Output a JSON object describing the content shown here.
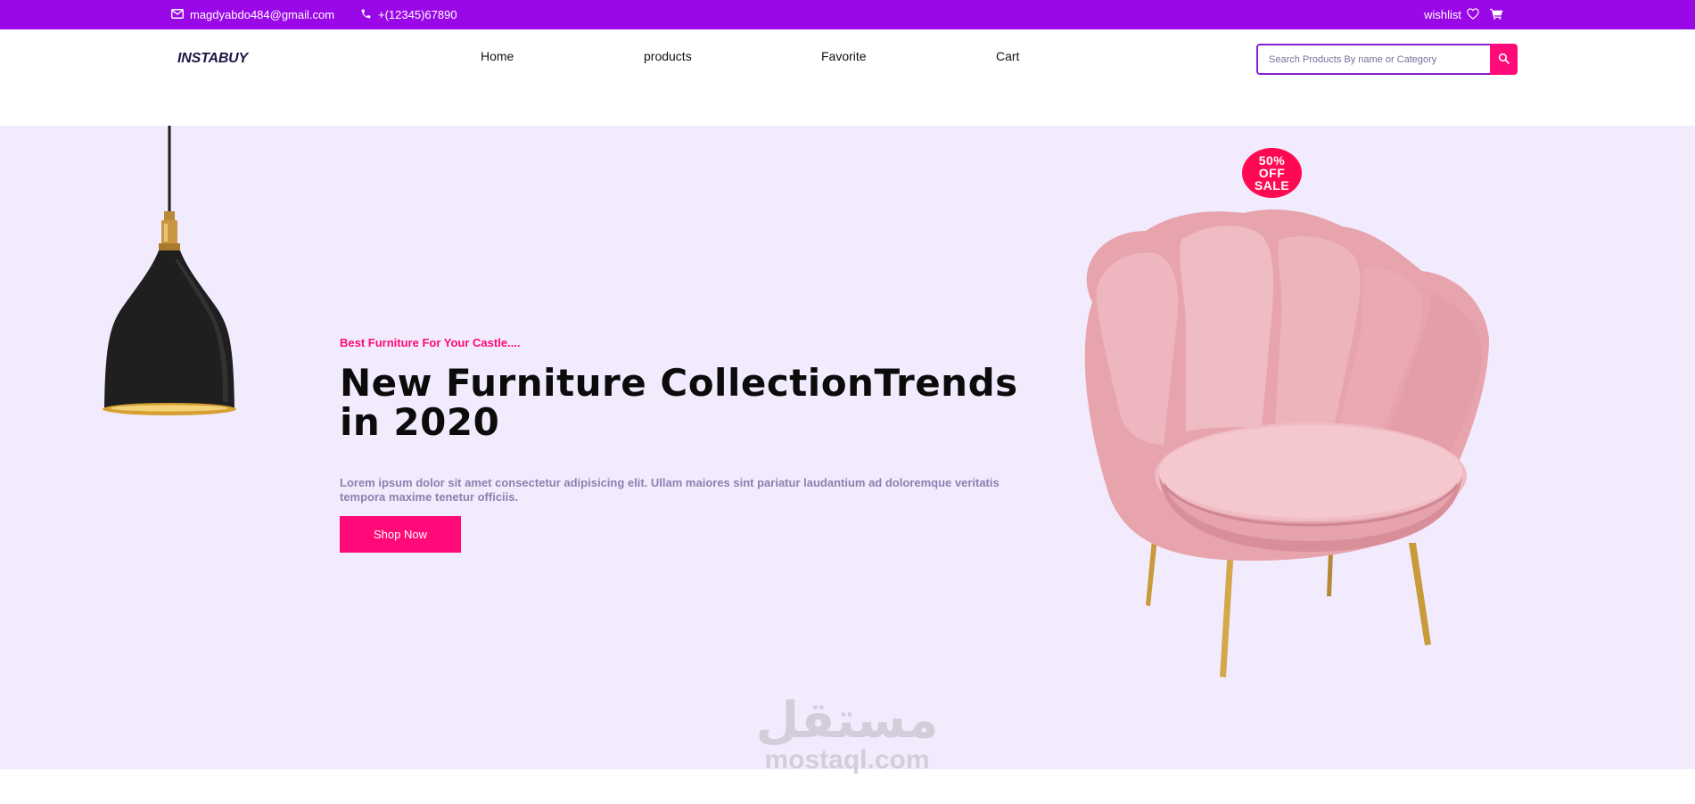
{
  "topbar": {
    "email": "magdyabdo484@gmail.com",
    "phone": "+(12345)67890",
    "wishlist_label": "wishlist",
    "icons": [
      "envelope-icon",
      "phone-icon",
      "heart-icon",
      "cart-icon"
    ]
  },
  "navbar": {
    "logo": "INSTABUY",
    "links": [
      "Home",
      "products",
      "Favorite",
      "Cart"
    ],
    "search_placeholder": "Search Products By name or Category",
    "search_icon": "search-icon"
  },
  "hero": {
    "tagline": "Best Furniture For Your Castle....",
    "headline": "New Furniture CollectionTrends in 2020",
    "description": "Lorem ipsum dolor sit amet consectetur adipisicing elit. Ullam maiores sint pariatur laudantium ad doloremque veritatis tempora maxime tenetur officiis.",
    "button_label": "Shop Now",
    "sale_badge": [
      "50%",
      "OFF",
      "SALE"
    ]
  },
  "watermark": {
    "arabic": "مستقل",
    "latin": "mostaql.com"
  },
  "colors": {
    "topbar": "#9b08e8",
    "accent": "#ff0a78",
    "hero_bg": "#f2ebfd",
    "chair": "#e9a7b0"
  }
}
